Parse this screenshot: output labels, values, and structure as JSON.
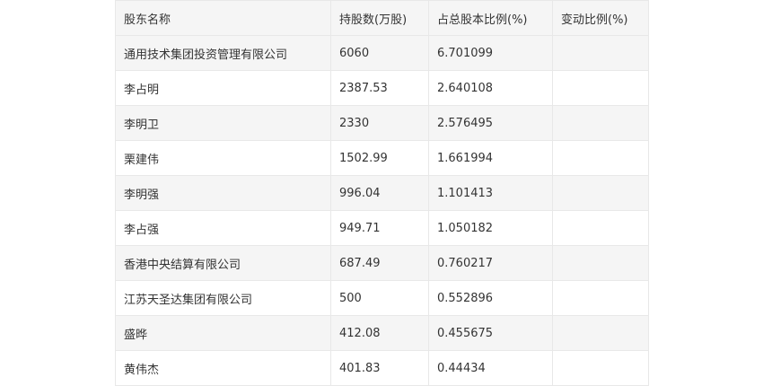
{
  "table": {
    "headers": [
      "股东名称",
      "持股数(万股)",
      "占总股本比例(%)",
      "变动比例(%)"
    ],
    "rows": [
      {
        "name": "通用技术集团投资管理有限公司",
        "shares": "6060",
        "ratio": "6.701099",
        "change": ""
      },
      {
        "name": "李占明",
        "shares": "2387.53",
        "ratio": "2.640108",
        "change": ""
      },
      {
        "name": "李明卫",
        "shares": "2330",
        "ratio": "2.576495",
        "change": ""
      },
      {
        "name": "栗建伟",
        "shares": "1502.99",
        "ratio": "1.661994",
        "change": ""
      },
      {
        "name": "李明强",
        "shares": "996.04",
        "ratio": "1.101413",
        "change": ""
      },
      {
        "name": "李占强",
        "shares": "949.71",
        "ratio": "1.050182",
        "change": ""
      },
      {
        "name": "香港中央结算有限公司",
        "shares": "687.49",
        "ratio": "0.760217",
        "change": ""
      },
      {
        "name": "江苏天圣达集团有限公司",
        "shares": "500",
        "ratio": "0.552896",
        "change": ""
      },
      {
        "name": "盛晔",
        "shares": "412.08",
        "ratio": "0.455675",
        "change": ""
      },
      {
        "name": "黄伟杰",
        "shares": "401.83",
        "ratio": "0.44434",
        "change": ""
      }
    ]
  }
}
